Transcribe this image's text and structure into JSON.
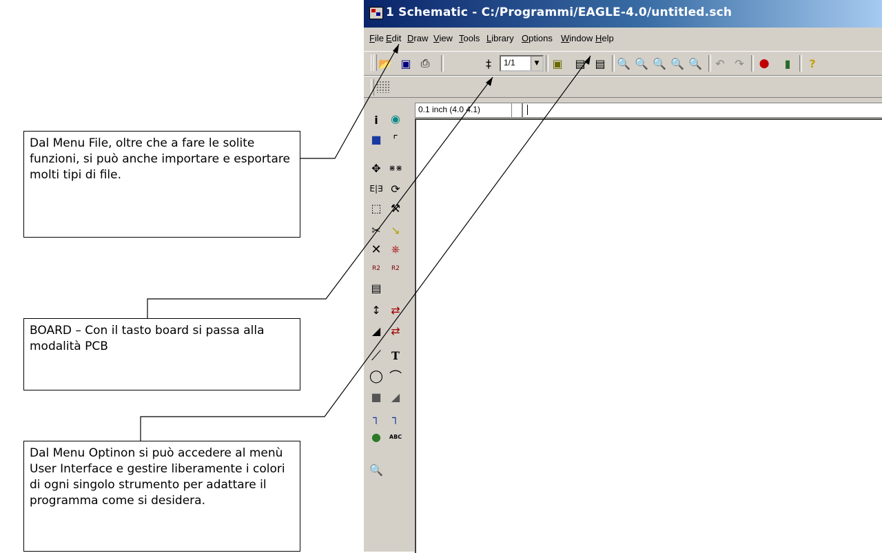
{
  "window": {
    "title": "1 Schematic - C:/Programmi/EAGLE-4.0/untitled.sch"
  },
  "menu": [
    "File",
    "Edit",
    "Draw",
    "View",
    "Tools",
    "Library",
    "Options",
    "Window",
    "Help"
  ],
  "toolbar": {
    "zoom_value": "1/1",
    "buttons": [
      "open-icon",
      "save-icon",
      "print-icon",
      "sheet-icon",
      "board-icon",
      "script-icon",
      "ulp-icon",
      "zoom-fit-icon",
      "zoom-in-icon",
      "zoom-out-icon",
      "redraw-icon",
      "zoom-select-icon",
      "undo-icon",
      "redo-icon",
      "stop-icon",
      "go-icon",
      "help-icon"
    ]
  },
  "status": {
    "coordinates": "0.1 inch (4.0 4.1)",
    "command": ""
  },
  "tools": [
    "info",
    "show",
    "display",
    "mark",
    "move",
    "copy",
    "mirror",
    "rotate",
    "group",
    "change",
    "cut",
    "paste",
    "delete",
    "add",
    "name",
    "value",
    "smash",
    "pinswap",
    "gateswap",
    "split",
    "invoke",
    "wire",
    "text",
    "circle",
    "arc",
    "rect",
    "polygon",
    "bus",
    "net",
    "junction",
    "label",
    "erc"
  ],
  "annotations": {
    "file_menu": "Dal Menu File, oltre che a fare le solite funzioni, si può anche importare e esportare molti tipi di file.",
    "board": "BOARD – Con il tasto board si passa alla modalità PCB",
    "options_menu": "Dal Menu Optinon si può accedere al menù User Interface e gestire liberamente i colori di ogni singolo strumento per adattare il programma come si desidera."
  }
}
